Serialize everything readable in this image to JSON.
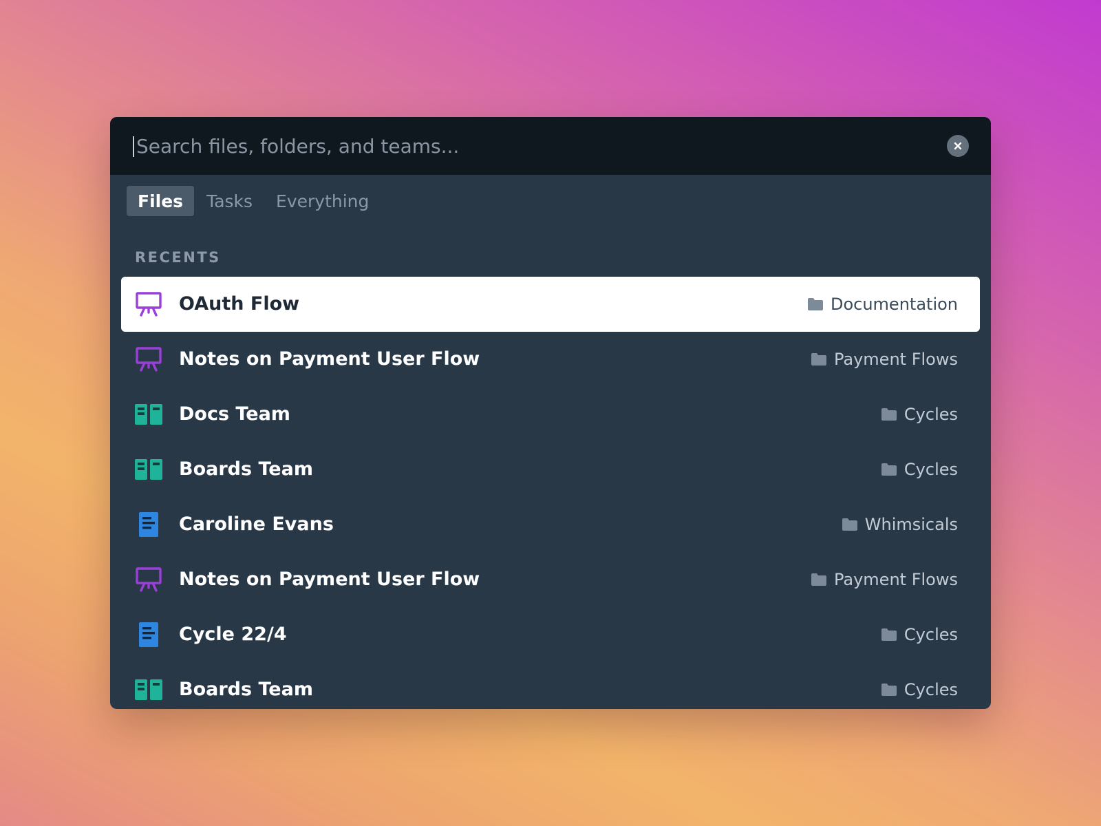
{
  "search": {
    "placeholder": "Search files, folders, and teams...",
    "value": ""
  },
  "tabs": [
    {
      "label": "Files",
      "active": true
    },
    {
      "label": "Tasks",
      "active": false
    },
    {
      "label": "Everything",
      "active": false
    }
  ],
  "section": {
    "label": "RECENTS"
  },
  "items": [
    {
      "title": "OAuth Flow",
      "icon": "presentation-icon",
      "location": "Documentation",
      "selected": true
    },
    {
      "title": "Notes on Payment User Flow",
      "icon": "presentation-icon",
      "location": "Payment Flows",
      "selected": false
    },
    {
      "title": "Docs Team",
      "icon": "board-icon",
      "location": "Cycles",
      "selected": false
    },
    {
      "title": "Boards Team",
      "icon": "board-icon",
      "location": "Cycles",
      "selected": false
    },
    {
      "title": "Caroline Evans",
      "icon": "document-icon",
      "location": "Whimsicals",
      "selected": false
    },
    {
      "title": "Notes on Payment User Flow",
      "icon": "presentation-icon",
      "location": "Payment Flows",
      "selected": false
    },
    {
      "title": "Cycle 22/4",
      "icon": "document-icon",
      "location": "Cycles",
      "selected": false
    },
    {
      "title": "Boards Team",
      "icon": "board-icon",
      "location": "Cycles",
      "selected": false
    }
  ],
  "colors": {
    "presentation": "#9a3fd8",
    "board": "#1fb39a",
    "document": "#2f86e0",
    "folder": "#7d8a97"
  }
}
